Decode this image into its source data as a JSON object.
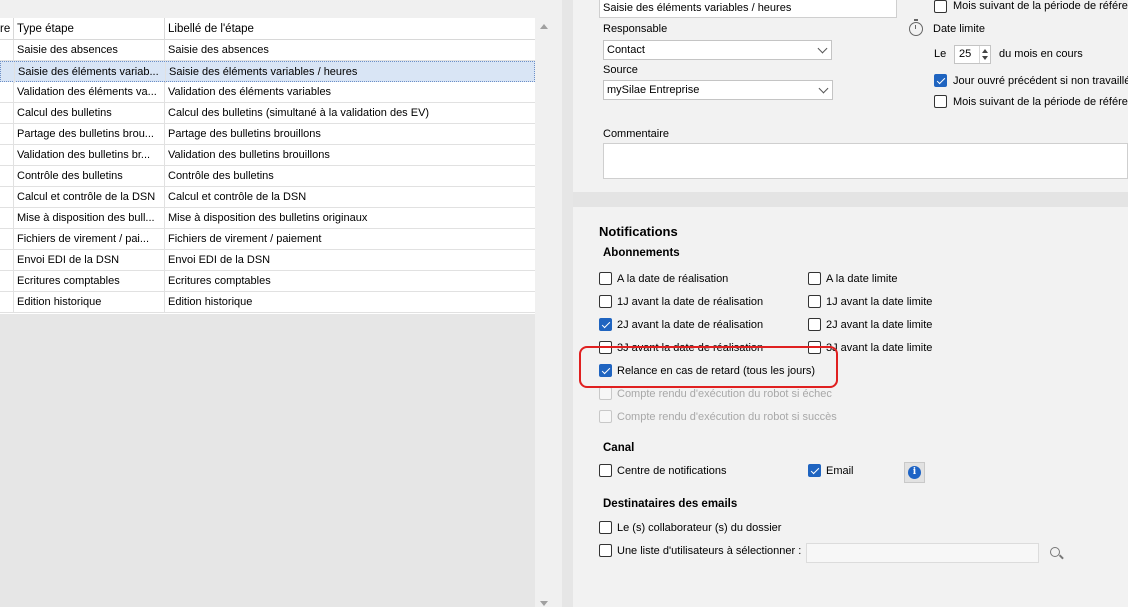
{
  "grid": {
    "headers": {
      "col0": "re",
      "col1": "Type étape",
      "col2": "Libellé de l'étape"
    },
    "rows": [
      {
        "type": "Saisie des absences",
        "label": "Saisie des absences"
      },
      {
        "type": "Saisie des éléments variab...",
        "label": "Saisie des éléments variables / heures"
      },
      {
        "type": "Validation des éléments va...",
        "label": "Validation des éléments variables"
      },
      {
        "type": "Calcul des bulletins",
        "label": "Calcul des bulletins (simultané à la validation des EV)"
      },
      {
        "type": "Partage des bulletins brou...",
        "label": "Partage des bulletins brouillons"
      },
      {
        "type": "Validation des bulletins br...",
        "label": "Validation des bulletins brouillons"
      },
      {
        "type": "Contrôle des bulletins",
        "label": "Contrôle des bulletins"
      },
      {
        "type": "Calcul et contrôle de la DSN",
        "label": "Calcul et contrôle de la DSN"
      },
      {
        "type": "Mise à disposition des bull...",
        "label": "Mise à disposition des bulletins originaux"
      },
      {
        "type": "Fichiers de virement / pai...",
        "label": "Fichiers de virement / paiement"
      },
      {
        "type": "Envoi EDI de la DSN",
        "label": "Envoi EDI de la DSN"
      },
      {
        "type": "Ecritures comptables",
        "label": "Ecritures comptables"
      },
      {
        "type": "Edition historique",
        "label": "Edition historique"
      }
    ],
    "selected_index": 1
  },
  "detail": {
    "step_label_value": "Saisie des éléments variables / heures",
    "responsable_label": "Responsable",
    "responsable_value": "Contact",
    "source_label": "Source",
    "source_value": "mySilae Entreprise",
    "commentaire_label": "Commentaire",
    "commentaire_value": "",
    "mois_suivant_top_label": "Mois suivant de la période de référer",
    "mois_suivant_top_checked": false,
    "date_limite_label": "Date limite",
    "le_label": "Le",
    "day_value": "25",
    "du_mois_label": "du mois en cours",
    "jour_ouvre_label": "Jour ouvré précédent si non travaillé",
    "jour_ouvre_checked": true,
    "mois_suivant_label": "Mois suivant de la période de référer",
    "mois_suivant_checked": false
  },
  "notifications": {
    "title": "Notifications",
    "abonnements_label": "Abonnements",
    "left_options": [
      {
        "label": "A la date de réalisation",
        "checked": false
      },
      {
        "label": "1J avant la date de réalisation",
        "checked": false
      },
      {
        "label": "2J avant la date de réalisation",
        "checked": true
      },
      {
        "label": "3J avant la date de réalisation",
        "checked": false
      }
    ],
    "right_options": [
      {
        "label": "A la date limite",
        "checked": false
      },
      {
        "label": "1J avant la date limite",
        "checked": false
      },
      {
        "label": "2J avant la date limite",
        "checked": false
      },
      {
        "label": "3J avant la date limite",
        "checked": false
      }
    ],
    "relance_label": "Relance en cas de retard (tous les jours)",
    "relance_checked": true,
    "robot_echec_label": "Compte rendu d'exécution du robot si échec",
    "robot_succes_label": "Compte rendu d'exécution du robot si succès",
    "canal_label": "Canal",
    "centre_label": "Centre de notifications",
    "centre_checked": false,
    "email_label": "Email",
    "email_checked": true,
    "destinataires_label": "Destinataires des emails",
    "collaborateur_label": "Le (s) collaborateur (s) du dossier",
    "collaborateur_checked": false,
    "liste_label": "Une liste d'utilisateurs à sélectionner :",
    "liste_checked": false,
    "liste_value": ""
  },
  "icons": {
    "clock": "stopwatch-icon",
    "info": "info-icon",
    "search": "search-icon",
    "dropdown": "chevron-down-icon"
  },
  "colors": {
    "accent": "#1f64c0",
    "selection": "#d9e5f5",
    "highlight": "#e02020"
  }
}
